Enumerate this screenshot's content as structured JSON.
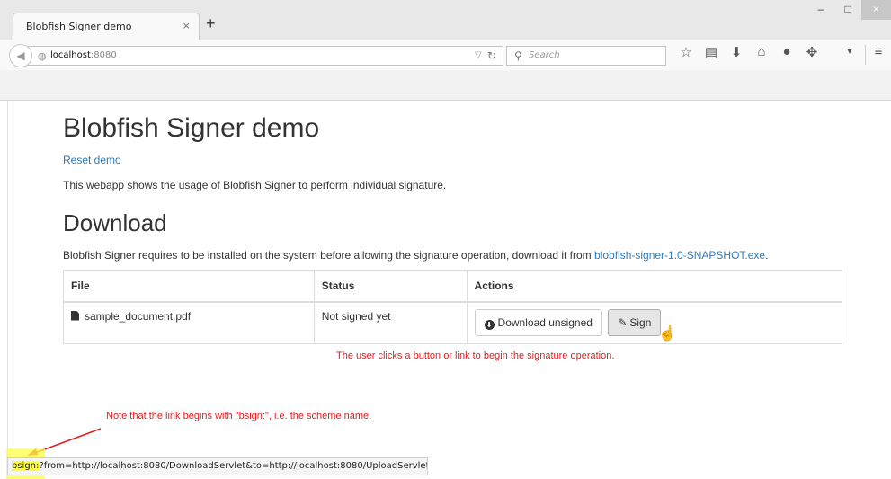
{
  "browser": {
    "tab_title": "Blobfish Signer demo",
    "tab_close": "×",
    "new_tab": "+",
    "url_host": "localhost",
    "url_port": ":8080",
    "search_placeholder": "Search",
    "window_min": "–",
    "window_max": "□",
    "window_close": "×"
  },
  "page": {
    "title": "Blobfish Signer demo",
    "reset_link": "Reset demo",
    "description": "This webapp shows the usage of Blobfish Signer to perform individual signature.",
    "download_heading": "Download",
    "requirement_text": "Blobfish Signer requires to be installed on the system before allowing the signature operation, download it from ",
    "installer_link": "blobfish-signer-1.0-SNAPSHOT.exe",
    "requirement_end": "."
  },
  "table": {
    "headers": [
      "File",
      "Status",
      "Actions"
    ],
    "rows": [
      {
        "file": "sample_document.pdf",
        "status": "Not signed yet",
        "download_label": "Download unsigned",
        "sign_label": "Sign"
      }
    ]
  },
  "annotations": {
    "button_note": "The user clicks a button or link to begin the signature operation.",
    "scheme_note": "Note that the link begins with \"bsign:\", i.e. the scheme name."
  },
  "statusbar": {
    "scheme": "bsign:",
    "rest": "?from=http://localhost:8080/DownloadServlet&to=http://localhost:8080/UploadServlet"
  },
  "colors": {
    "link": "#337ab7",
    "annotation": "#e01e1e",
    "highlight": "#ffff44"
  }
}
